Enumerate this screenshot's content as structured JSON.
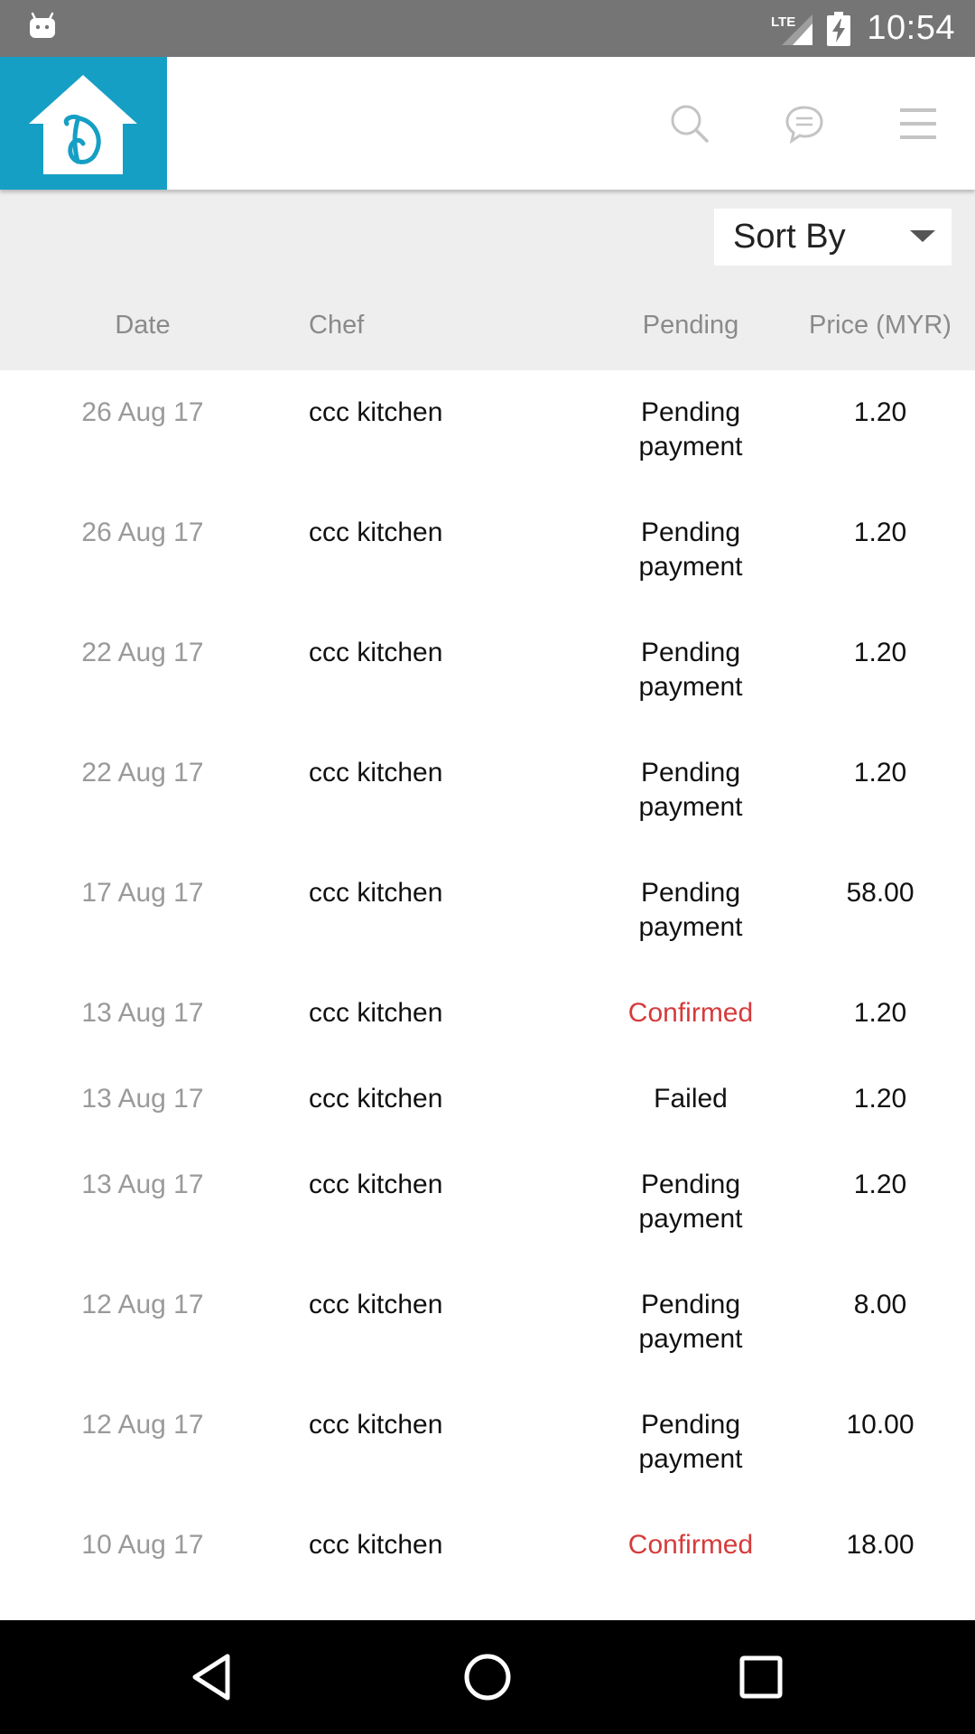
{
  "status_bar": {
    "time": "10:54",
    "network_label": "LTE",
    "icons": [
      "android-icon",
      "lte-signal-icon",
      "battery-charging-icon"
    ]
  },
  "app_bar": {
    "logo_letter": "D",
    "icons": [
      "search-icon",
      "chat-icon",
      "menu-icon"
    ]
  },
  "sort": {
    "label": "Sort By"
  },
  "table": {
    "headers": {
      "date": "Date",
      "chef": "Chef",
      "pending": "Pending",
      "price": "Price (MYR)"
    },
    "rows": [
      {
        "date": "26 Aug 17",
        "chef": "ccc kitchen",
        "status_line1": "Pending",
        "status_line2": "payment",
        "status_type": "pending",
        "price": "1.20"
      },
      {
        "date": "26 Aug 17",
        "chef": "ccc kitchen",
        "status_line1": "Pending",
        "status_line2": "payment",
        "status_type": "pending",
        "price": "1.20"
      },
      {
        "date": "22 Aug 17",
        "chef": "ccc kitchen",
        "status_line1": "Pending",
        "status_line2": "payment",
        "status_type": "pending",
        "price": "1.20"
      },
      {
        "date": "22 Aug 17",
        "chef": "ccc kitchen",
        "status_line1": "Pending",
        "status_line2": "payment",
        "status_type": "pending",
        "price": "1.20"
      },
      {
        "date": "17 Aug 17",
        "chef": "ccc kitchen",
        "status_line1": "Pending",
        "status_line2": "payment",
        "status_type": "pending",
        "price": "58.00"
      },
      {
        "date": "13 Aug 17",
        "chef": "ccc kitchen",
        "status_line1": "Confirmed",
        "status_line2": "",
        "status_type": "confirmed",
        "price": "1.20"
      },
      {
        "date": "13 Aug 17",
        "chef": "ccc kitchen",
        "status_line1": "Failed",
        "status_line2": "",
        "status_type": "failed",
        "price": "1.20"
      },
      {
        "date": "13 Aug 17",
        "chef": "ccc kitchen",
        "status_line1": "Pending",
        "status_line2": "payment",
        "status_type": "pending",
        "price": "1.20"
      },
      {
        "date": "12 Aug 17",
        "chef": "ccc kitchen",
        "status_line1": "Pending",
        "status_line2": "payment",
        "status_type": "pending",
        "price": "8.00"
      },
      {
        "date": "12 Aug 17",
        "chef": "ccc kitchen",
        "status_line1": "Pending",
        "status_line2": "payment",
        "status_type": "pending",
        "price": "10.00"
      },
      {
        "date": "10 Aug 17",
        "chef": "ccc kitchen",
        "status_line1": "Confirmed",
        "status_line2": "",
        "status_type": "confirmed",
        "price": "18.00"
      }
    ]
  },
  "colors": {
    "brand": "#169fc4",
    "status_bar": "#757575",
    "confirmed": "#d63b3b",
    "header_bg": "#eeeeee"
  },
  "nav_bar": {
    "icons": [
      "back-icon",
      "home-icon",
      "recent-apps-icon"
    ]
  }
}
